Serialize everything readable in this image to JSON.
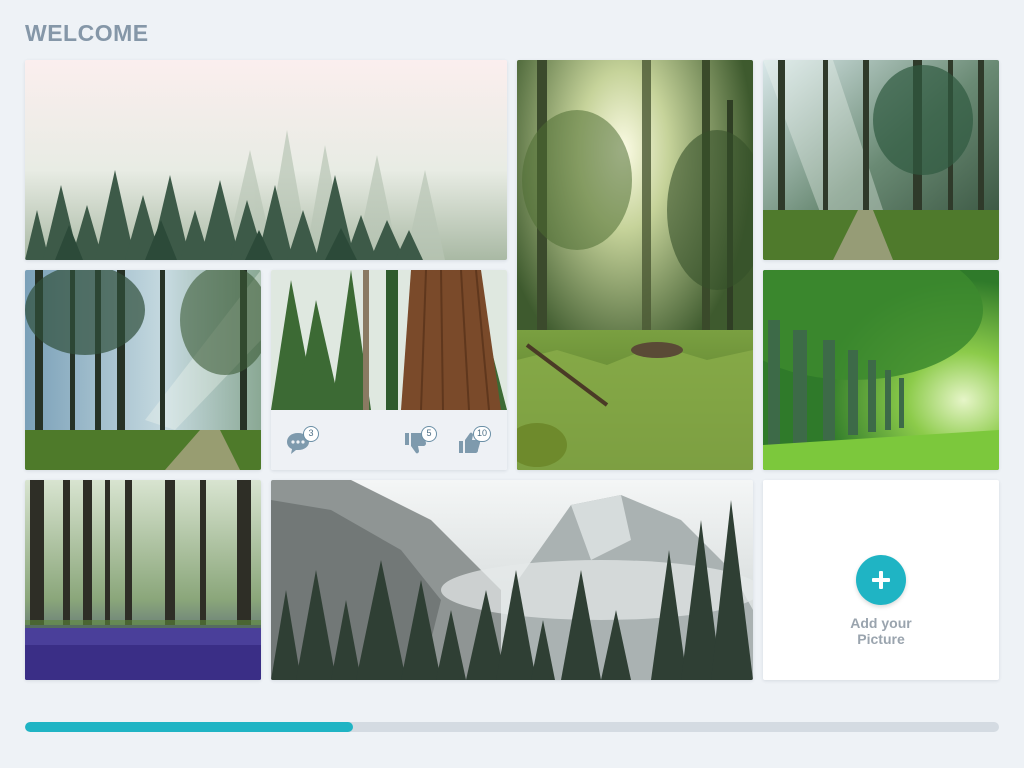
{
  "header": {
    "title": "WELCOME"
  },
  "gallery": {
    "tiles": [
      {
        "name": "misty-pine-forest"
      },
      {
        "name": "sunlit-forest-floor"
      },
      {
        "name": "forest-path-sunrays"
      },
      {
        "name": "sunbeam-forest-trail"
      },
      {
        "name": "redwood-trunk"
      },
      {
        "name": "green-tree-tunnel"
      },
      {
        "name": "bluebell-forest"
      },
      {
        "name": "granite-mountain-pines"
      }
    ],
    "featured": {
      "comments": "3",
      "dislikes": "5",
      "likes": "10",
      "icons": [
        "comment-icon",
        "thumbs-down-icon",
        "thumbs-up-icon"
      ]
    }
  },
  "add_picture": {
    "label": "Add your\nPicture",
    "icon": "plus-icon"
  },
  "progress": {
    "value": 0.337
  },
  "colors": {
    "accent": "#1fb4c4",
    "title": "#8597a8",
    "background": "#eef2f6",
    "track": "#d4dbe2"
  }
}
